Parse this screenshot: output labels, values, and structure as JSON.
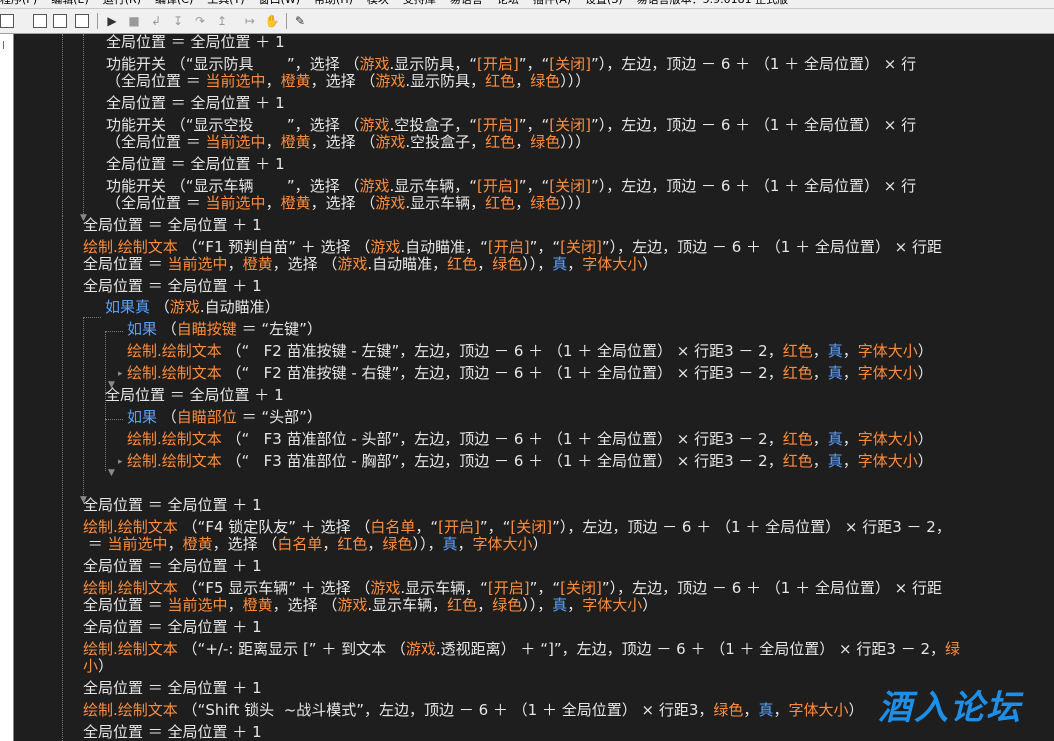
{
  "menubar": {
    "items": [
      "程序(P)",
      "编辑(E)",
      "运行(R)",
      "编译(C)",
      "工具(T)",
      "窗口(W)",
      "帮助(H)",
      "模块",
      "支持库",
      "易语言",
      "论坛",
      "插件(A)",
      "设置(S)"
    ],
    "version_text": "易语言版本：5.9.0181 正式版"
  },
  "toolbar": {
    "icons": [
      "window-icon",
      "layout-icon",
      "layout2-icon",
      "layout3-icon",
      "run-icon",
      "stop-icon",
      "step-icon",
      "step-into-icon",
      "step-over-icon",
      "step-out-icon",
      "hand-icon",
      "debug-icon"
    ]
  },
  "code": {
    "lines": [
      [
        [
          "n",
          "全局位置 ＝ 全局位置 ＋ 1"
        ]
      ],
      [
        [
          "n",
          "功能开关 （“显示防具       ”，选择 （"
        ],
        [
          "o",
          "游戏"
        ],
        [
          "n",
          ".显示防具，“"
        ],
        [
          "o",
          "[开启]"
        ],
        [
          "n",
          "”，“"
        ],
        [
          "o",
          "[关闭]"
        ],
        [
          "n",
          "”），左边，顶边 － 6 ＋ （1 ＋ 全局位置） × 行"
        ]
      ],
      [
        [
          "n",
          "（全局位置 ＝ "
        ],
        [
          "o",
          "当前选中"
        ],
        [
          "n",
          "，"
        ],
        [
          "o",
          "橙黄"
        ],
        [
          "n",
          "，选择 （"
        ],
        [
          "o",
          "游戏"
        ],
        [
          "n",
          ".显示防具，"
        ],
        [
          "o",
          "红色"
        ],
        [
          "n",
          "，"
        ],
        [
          "o",
          "绿色"
        ],
        [
          "n",
          "）））"
        ]
      ],
      [
        [
          "n",
          "全局位置 ＝ 全局位置 ＋ 1"
        ]
      ],
      [
        [
          "n",
          "功能开关 （“显示空投       ”，选择 （"
        ],
        [
          "o",
          "游戏"
        ],
        [
          "n",
          ".空投盒子，“"
        ],
        [
          "o",
          "[开启]"
        ],
        [
          "n",
          "”，“"
        ],
        [
          "o",
          "[关闭]"
        ],
        [
          "n",
          "”），左边，顶边 － 6 ＋ （1 ＋ 全局位置） × 行"
        ]
      ],
      [
        [
          "n",
          "（全局位置 ＝ "
        ],
        [
          "o",
          "当前选中"
        ],
        [
          "n",
          "，"
        ],
        [
          "o",
          "橙黄"
        ],
        [
          "n",
          "，选择 （"
        ],
        [
          "o",
          "游戏"
        ],
        [
          "n",
          ".空投盒子，"
        ],
        [
          "o",
          "红色"
        ],
        [
          "n",
          "，"
        ],
        [
          "o",
          "绿色"
        ],
        [
          "n",
          "）））"
        ]
      ],
      [
        [
          "n",
          "全局位置 ＝ 全局位置 ＋ 1"
        ]
      ],
      [
        [
          "n",
          "功能开关 （“显示车辆       ”，选择 （"
        ],
        [
          "o",
          "游戏"
        ],
        [
          "n",
          ".显示车辆，“"
        ],
        [
          "o",
          "[开启]"
        ],
        [
          "n",
          "”，“"
        ],
        [
          "o",
          "[关闭]"
        ],
        [
          "n",
          "”），左边，顶边 － 6 ＋ （1 ＋ 全局位置） × 行"
        ]
      ],
      [
        [
          "n",
          "（全局位置 ＝ "
        ],
        [
          "o",
          "当前选中"
        ],
        [
          "n",
          "，"
        ],
        [
          "o",
          "橙黄"
        ],
        [
          "n",
          "，选择 （"
        ],
        [
          "o",
          "游戏"
        ],
        [
          "n",
          ".显示车辆，"
        ],
        [
          "o",
          "红色"
        ],
        [
          "n",
          "，"
        ],
        [
          "o",
          "绿色"
        ],
        [
          "n",
          "）））"
        ]
      ],
      [
        [
          "n",
          "全局位置 ＝ 全局位置 ＋ 1"
        ]
      ],
      [
        [
          "o",
          "绘制.绘制文本"
        ],
        [
          "n",
          " （“F1 预判自苗” ＋ 选择 （"
        ],
        [
          "o",
          "游戏"
        ],
        [
          "n",
          ".自动瞄准，“"
        ],
        [
          "o",
          "[开启]"
        ],
        [
          "n",
          "”，“"
        ],
        [
          "o",
          "[关闭]"
        ],
        [
          "n",
          "”），左边，顶边 － 6 ＋ （1 ＋ 全局位置） × 行距"
        ]
      ],
      [
        [
          "n",
          "全局位置 ＝ "
        ],
        [
          "o",
          "当前选中"
        ],
        [
          "n",
          "，"
        ],
        [
          "o",
          "橙黄"
        ],
        [
          "n",
          "，选择 （"
        ],
        [
          "o",
          "游戏"
        ],
        [
          "n",
          ".自动瞄准，"
        ],
        [
          "o",
          "红色"
        ],
        [
          "n",
          "，"
        ],
        [
          "o",
          "绿色"
        ],
        [
          "n",
          "）），"
        ],
        [
          "b",
          "真"
        ],
        [
          "n",
          "，"
        ],
        [
          "o",
          "字体大小"
        ],
        [
          "n",
          "）"
        ]
      ],
      [
        [
          "n",
          "全局位置 ＝ 全局位置 ＋ 1"
        ]
      ],
      [
        [
          "b",
          "如果真"
        ],
        [
          "n",
          " （"
        ],
        [
          "o",
          "游戏"
        ],
        [
          "n",
          ".自动瞄准）"
        ]
      ],
      [
        [
          "b",
          "如果"
        ],
        [
          "n",
          " （"
        ],
        [
          "o",
          "自瞄按键"
        ],
        [
          "n",
          " ＝ “左键”）"
        ]
      ],
      [
        [
          "o",
          "绘制.绘制文本"
        ],
        [
          "n",
          " （“   F2 苗准按键 - 左键”，左边，顶边 － 6 ＋ （1 ＋ 全局位置） × 行距3 － 2，"
        ],
        [
          "o",
          "红色"
        ],
        [
          "n",
          "，"
        ],
        [
          "b",
          "真"
        ],
        [
          "n",
          "，"
        ],
        [
          "o",
          "字体大小"
        ],
        [
          "n",
          "）"
        ]
      ],
      [
        [
          "o",
          "绘制.绘制文本"
        ],
        [
          "n",
          " （“   F2 苗准按键 - 右键”，左边，顶边 － 6 ＋ （1 ＋ 全局位置） × 行距3 － 2，"
        ],
        [
          "o",
          "红色"
        ],
        [
          "n",
          "，"
        ],
        [
          "b",
          "真"
        ],
        [
          "n",
          "，"
        ],
        [
          "o",
          "字体大小"
        ],
        [
          "n",
          "）"
        ]
      ],
      [
        [
          "n",
          "全局位置 ＝ 全局位置 ＋ 1"
        ]
      ],
      [
        [
          "b",
          "如果"
        ],
        [
          "n",
          " （"
        ],
        [
          "o",
          "自瞄部位"
        ],
        [
          "n",
          " ＝ “头部”）"
        ]
      ],
      [
        [
          "o",
          "绘制.绘制文本"
        ],
        [
          "n",
          " （“   F3 苗准部位 - 头部”，左边，顶边 － 6 ＋ （1 ＋ 全局位置） × 行距3 － 2，"
        ],
        [
          "o",
          "红色"
        ],
        [
          "n",
          "，"
        ],
        [
          "b",
          "真"
        ],
        [
          "n",
          "，"
        ],
        [
          "o",
          "字体大小"
        ],
        [
          "n",
          "）"
        ]
      ],
      [
        [
          "o",
          "绘制.绘制文本"
        ],
        [
          "n",
          " （“   F3 苗准部位 - 胸部”，左边，顶边 － 6 ＋ （1 ＋ 全局位置） × 行距3 － 2，"
        ],
        [
          "o",
          "红色"
        ],
        [
          "n",
          "，"
        ],
        [
          "b",
          "真"
        ],
        [
          "n",
          "，"
        ],
        [
          "o",
          "字体大小"
        ],
        [
          "n",
          "）"
        ]
      ],
      [
        [
          "n",
          "全局位置 ＝ 全局位置 ＋ 1"
        ]
      ],
      [
        [
          "o",
          "绘制.绘制文本"
        ],
        [
          "n",
          " （“F4 锁定队友” ＋ 选择 （"
        ],
        [
          "o",
          "白名单"
        ],
        [
          "n",
          "，“"
        ],
        [
          "o",
          "[开启]"
        ],
        [
          "n",
          "”，“"
        ],
        [
          "o",
          "[关闭]"
        ],
        [
          "n",
          "”），左边，顶边 － 6 ＋ （1 ＋ 全局位置） × 行距3 － 2，"
        ]
      ],
      [
        [
          "n",
          " ＝ "
        ],
        [
          "o",
          "当前选中"
        ],
        [
          "n",
          "，"
        ],
        [
          "o",
          "橙黄"
        ],
        [
          "n",
          "，选择 （"
        ],
        [
          "o",
          "白名单"
        ],
        [
          "n",
          "，"
        ],
        [
          "o",
          "红色"
        ],
        [
          "n",
          "，"
        ],
        [
          "o",
          "绿色"
        ],
        [
          "n",
          "）），"
        ],
        [
          "b",
          "真"
        ],
        [
          "n",
          "，"
        ],
        [
          "o",
          "字体大小"
        ],
        [
          "n",
          "）"
        ]
      ],
      [
        [
          "n",
          "全局位置 ＝ 全局位置 ＋ 1"
        ]
      ],
      [
        [
          "o",
          "绘制.绘制文本"
        ],
        [
          "n",
          " （“F5 显示车辆” ＋ 选择 （"
        ],
        [
          "o",
          "游戏"
        ],
        [
          "n",
          ".显示车辆，“"
        ],
        [
          "o",
          "[开启]"
        ],
        [
          "n",
          "”，“"
        ],
        [
          "o",
          "[关闭]"
        ],
        [
          "n",
          "”），左边，顶边 － 6 ＋ （1 ＋ 全局位置） × 行距"
        ]
      ],
      [
        [
          "n",
          "全局位置 ＝ "
        ],
        [
          "o",
          "当前选中"
        ],
        [
          "n",
          "，"
        ],
        [
          "o",
          "橙黄"
        ],
        [
          "n",
          "，选择 （"
        ],
        [
          "o",
          "游戏"
        ],
        [
          "n",
          ".显示车辆，"
        ],
        [
          "o",
          "红色"
        ],
        [
          "n",
          "，"
        ],
        [
          "o",
          "绿色"
        ],
        [
          "n",
          "）），"
        ],
        [
          "b",
          "真"
        ],
        [
          "n",
          "，"
        ],
        [
          "o",
          "字体大小"
        ],
        [
          "n",
          "）"
        ]
      ],
      [
        [
          "n",
          "全局位置 ＝ 全局位置 ＋ 1"
        ]
      ],
      [
        [
          "o",
          "绘制.绘制文本"
        ],
        [
          "n",
          " （“+/-: 距离显示 [” ＋ 到文本 （"
        ],
        [
          "o",
          "游戏"
        ],
        [
          "n",
          ".透视距离） ＋ “]”，左边，顶边 － 6 ＋ （1 ＋ 全局位置） × 行距3 － 2，"
        ],
        [
          "o",
          "绿"
        ]
      ],
      [
        [
          "o",
          "小"
        ],
        [
          "n",
          "）"
        ]
      ],
      [
        [
          "n",
          "全局位置 ＝ 全局位置 ＋ 1"
        ]
      ],
      [
        [
          "o",
          "绘制.绘制文本"
        ],
        [
          "n",
          " （“Shift 锁头  ~战斗模式”，左边，顶边 － 6 ＋ （1 ＋ 全局位置） × 行距3，"
        ],
        [
          "o",
          "绿色"
        ],
        [
          "n",
          "，"
        ],
        [
          "b",
          "真"
        ],
        [
          "n",
          "，"
        ],
        [
          "o",
          "字体大小"
        ],
        [
          "n",
          "）"
        ]
      ],
      [
        [
          "n",
          "全局位置 ＝ 全局位置 ＋ 1"
        ]
      ]
    ]
  },
  "watermark": {
    "text": "酒入论坛"
  }
}
